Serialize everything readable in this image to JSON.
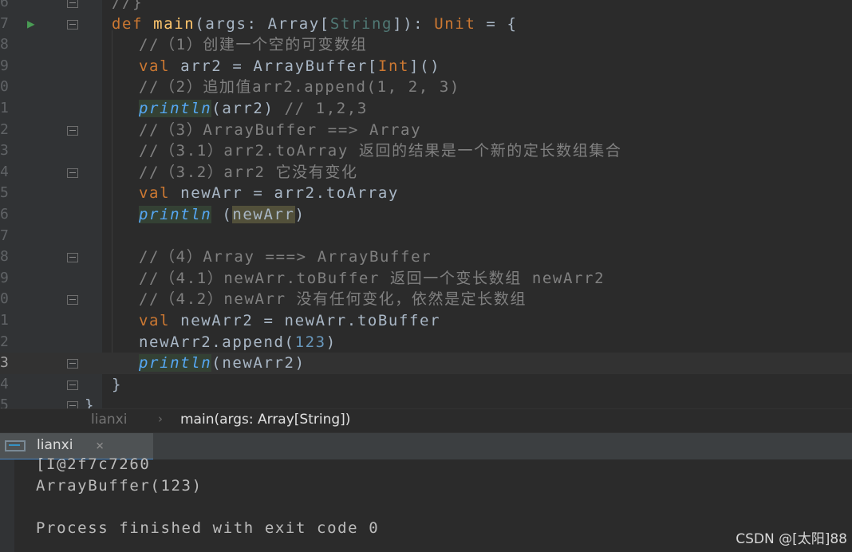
{
  "editor": {
    "lines": [
      {
        "num": "6",
        "fold": true,
        "indent": 1,
        "tokens": [
          {
            "t": "//}",
            "c": "cm"
          }
        ]
      },
      {
        "num": "7",
        "run": true,
        "fold": true,
        "indent": 1,
        "tokens": [
          {
            "t": "def ",
            "c": "kw"
          },
          {
            "t": "main",
            "c": "fn"
          },
          {
            "t": "(args: ",
            "c": "pl"
          },
          {
            "t": "Array",
            "c": "pl"
          },
          {
            "t": "[",
            "c": "pl"
          },
          {
            "t": "String",
            "c": "tp"
          },
          {
            "t": "]): ",
            "c": "pl"
          },
          {
            "t": "Unit",
            "c": "ty"
          },
          {
            "t": " = {",
            "c": "pl"
          }
        ]
      },
      {
        "num": "8",
        "indent": 2,
        "tokens": [
          {
            "t": "//（1）创建一个空的可变数组",
            "c": "cm"
          }
        ]
      },
      {
        "num": "9",
        "indent": 2,
        "tokens": [
          {
            "t": "val ",
            "c": "kw"
          },
          {
            "t": "arr2 = ArrayBuffer[",
            "c": "pl"
          },
          {
            "t": "Int",
            "c": "ty"
          },
          {
            "t": "]()",
            "c": "pl"
          }
        ]
      },
      {
        "num": "0",
        "indent": 2,
        "tokens": [
          {
            "t": "//（2）追加值arr2.append(1, 2, 3)",
            "c": "cm"
          }
        ]
      },
      {
        "num": "1",
        "indent": 2,
        "tokens": [
          {
            "t": "println",
            "c": "it"
          },
          {
            "t": "(arr2) ",
            "c": "pl"
          },
          {
            "t": "// 1,2,3",
            "c": "cm"
          }
        ]
      },
      {
        "num": "2",
        "fold": true,
        "indent": 2,
        "tokens": [
          {
            "t": "//（3）ArrayBuffer ==> Array",
            "c": "cm"
          }
        ]
      },
      {
        "num": "3",
        "indent": 2,
        "tokens": [
          {
            "t": "//（3.1）arr2.toArray 返回的结果是一个新的定长数组集合",
            "c": "cm"
          }
        ]
      },
      {
        "num": "4",
        "fold": true,
        "indent": 2,
        "tokens": [
          {
            "t": "//（3.2）arr2 它没有变化",
            "c": "cm"
          }
        ]
      },
      {
        "num": "5",
        "indent": 2,
        "tokens": [
          {
            "t": "val ",
            "c": "kw"
          },
          {
            "t": "newArr = arr2.toArray",
            "c": "pl"
          }
        ]
      },
      {
        "num": "6",
        "indent": 2,
        "tokens": [
          {
            "t": "println",
            "c": "it"
          },
          {
            "t": " (",
            "c": "pl"
          },
          {
            "t": "newArr",
            "c": "pl hl"
          },
          {
            "t": ")",
            "c": "pl"
          }
        ]
      },
      {
        "num": "7",
        "indent": 2,
        "tokens": []
      },
      {
        "num": "8",
        "fold": true,
        "indent": 2,
        "tokens": [
          {
            "t": "//（4）Array ===> ArrayBuffer",
            "c": "cm"
          }
        ]
      },
      {
        "num": "9",
        "indent": 2,
        "tokens": [
          {
            "t": "//（4.1）newArr.toBuffer 返回一个变长数组 newArr2",
            "c": "cm"
          }
        ]
      },
      {
        "num": "0",
        "fold": true,
        "indent": 2,
        "tokens": [
          {
            "t": "//（4.2）newArr 没有任何变化，依然是定长数组",
            "c": "cm"
          }
        ]
      },
      {
        "num": "1",
        "indent": 2,
        "tokens": [
          {
            "t": "val ",
            "c": "kw"
          },
          {
            "t": "newArr2 = newArr.toBuffer",
            "c": "pl"
          }
        ]
      },
      {
        "num": "2",
        "indent": 2,
        "tokens": [
          {
            "t": "newArr2.append(",
            "c": "pl"
          },
          {
            "t": "123",
            "c": "num"
          },
          {
            "t": ")",
            "c": "pl"
          }
        ]
      },
      {
        "num": "3",
        "fold": true,
        "indent": 2,
        "current": true,
        "tokens": [
          {
            "t": "println",
            "c": "it"
          },
          {
            "t": "(newArr2)",
            "c": "pl"
          }
        ]
      },
      {
        "num": "4",
        "fold": true,
        "indent": 1,
        "tokens": [
          {
            "t": "}",
            "c": "pl"
          }
        ]
      },
      {
        "num": "5",
        "fold": true,
        "indent": 0,
        "tokens": [
          {
            "t": "}",
            "c": "pl"
          }
        ]
      }
    ]
  },
  "breadcrumb": {
    "module": "lianxi",
    "separator": "›",
    "method": "main(args: Array[String])"
  },
  "run_panel": {
    "tab_label": "lianxi",
    "close_glyph": "×",
    "output": [
      "[I@2f7c7260",
      "ArrayBuffer(123)",
      "",
      "Process finished with exit code 0"
    ]
  },
  "watermark": "CSDN @[太阳]88"
}
